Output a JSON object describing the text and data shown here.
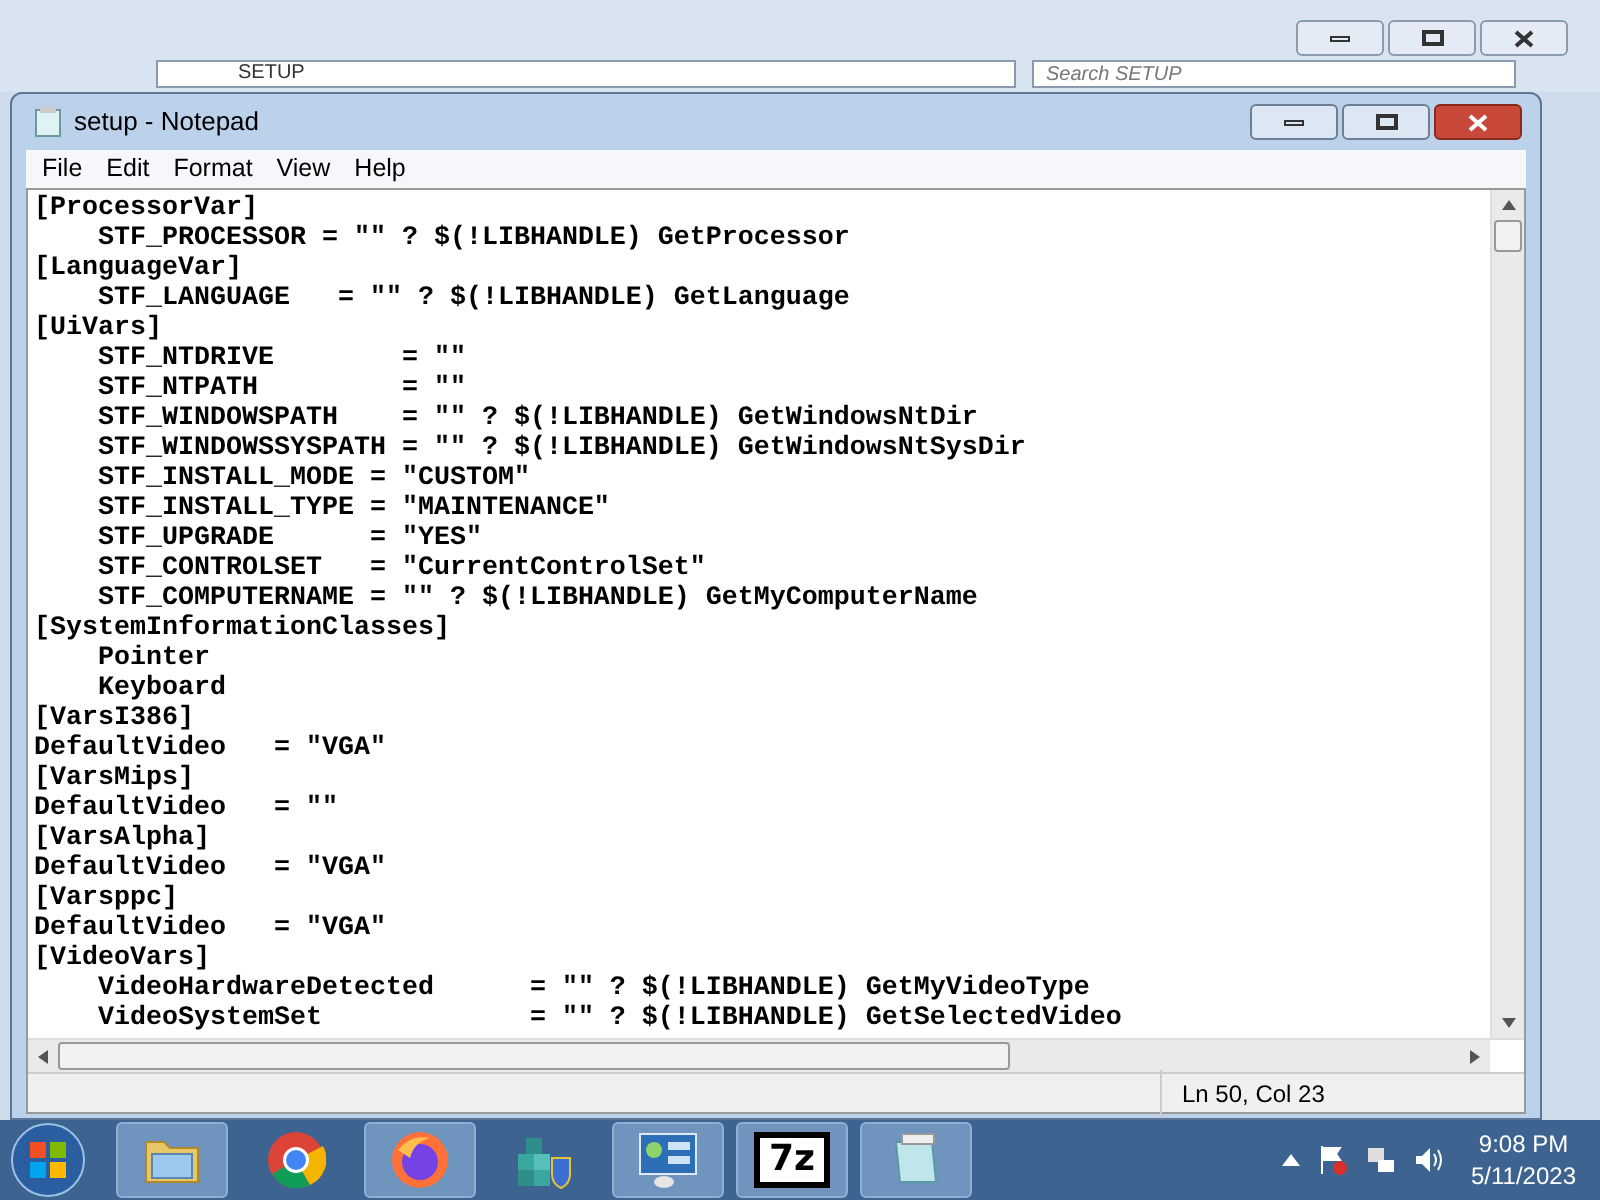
{
  "explorer": {
    "address": "SETUP",
    "search": {
      "placeholder": "Search SETUP"
    }
  },
  "window": {
    "title": "setup - Notepad"
  },
  "menu": [
    "File",
    "Edit",
    "Format",
    "View",
    "Help"
  ],
  "lines": [
    "[ProcessorVar]",
    "    STF_PROCESSOR = \"\" ? $(!LIBHANDLE) GetProcessor",
    "[LanguageVar]",
    "    STF_LANGUAGE   = \"\" ? $(!LIBHANDLE) GetLanguage",
    "[UiVars]",
    "    STF_NTDRIVE        = \"\"",
    "    STF_NTPATH         = \"\"",
    "    STF_WINDOWSPATH    = \"\" ? $(!LIBHANDLE) GetWindowsNtDir",
    "    STF_WINDOWSSYSPATH = \"\" ? $(!LIBHANDLE) GetWindowsNtSysDir",
    "    STF_INSTALL_MODE = \"CUSTOM\"",
    "    STF_INSTALL_TYPE = \"MAINTENANCE\"",
    "    STF_UPGRADE      = \"YES\"",
    "    STF_CONTROLSET   = \"CurrentControlSet\"",
    "    STF_COMPUTERNAME = \"\" ? $(!LIBHANDLE) GetMyComputerName",
    "[SystemInformationClasses]",
    "    Pointer",
    "    Keyboard",
    "[VarsI386]",
    "DefaultVideo   = \"VGA\"",
    "[VarsMips]",
    "DefaultVideo   = \"\"",
    "[VarsAlpha]",
    "DefaultVideo   = \"VGA\"",
    "[Varsppc]",
    "DefaultVideo   = \"VGA\"",
    "[VideoVars]",
    "    VideoHardwareDetected      = \"\" ? $(!LIBHANDLE) GetMyVideoType",
    "    VideoSystemSet             = \"\" ? $(!LIBHANDLE) GetSelectedVideo"
  ],
  "status_bar": {
    "position": "Ln 50, Col 23"
  },
  "taskbar": {
    "apps": [
      {
        "kind": "folder",
        "running": true
      },
      {
        "kind": "chrome",
        "running": false
      },
      {
        "kind": "firefox",
        "running": true
      },
      {
        "kind": "cubes",
        "running": false
      },
      {
        "kind": "panel",
        "running": true
      },
      {
        "kind": "sevenzip",
        "label": "7z",
        "running": true
      },
      {
        "kind": "notepad",
        "running": true
      }
    ],
    "time": "9:08 PM",
    "date": "5/11/2023"
  }
}
